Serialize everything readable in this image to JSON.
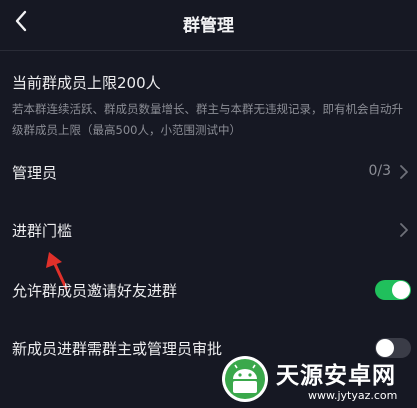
{
  "header": {
    "title": "群管理",
    "back_icon": "chevron-left-icon"
  },
  "member_limit": {
    "title": "当前群成员上限200人",
    "description": "若本群连续活跃、群成员数量增长、群主与本群无违规记录，即有机会自动升级群成员上限（最高500人，小范围测试中）"
  },
  "rows": {
    "admins": {
      "label": "管理员",
      "value": "0/3"
    },
    "threshold": {
      "label": "进群门槛"
    },
    "allow_invite": {
      "label": "允许群成员邀请好友进群",
      "enabled": true
    },
    "approval": {
      "label": "新成员进群需群主或管理员审批",
      "enabled": false
    }
  },
  "watermark": {
    "title": "天源安卓网",
    "url": "www.jytyaz.com"
  },
  "colors": {
    "background": "#161823",
    "toggle_on": "#20c05c",
    "toggle_off": "#3a3c47",
    "annotation_arrow": "#e0302a"
  }
}
